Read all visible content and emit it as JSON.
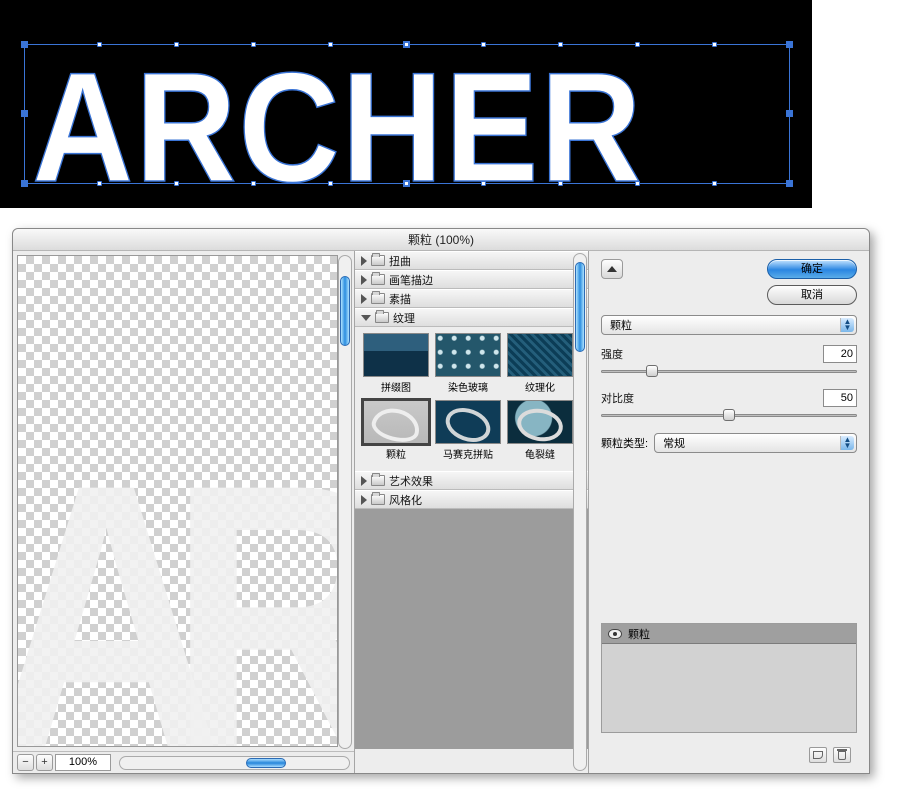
{
  "canvas": {
    "text": "ARCHER"
  },
  "dialog": {
    "title": "颗粒 (100%)",
    "zoom": "100%",
    "categories": [
      {
        "label": "扭曲",
        "open": false
      },
      {
        "label": "画笔描边",
        "open": false
      },
      {
        "label": "素描",
        "open": false
      },
      {
        "label": "纹理",
        "open": true,
        "items": [
          {
            "name": "拼缀图"
          },
          {
            "name": "染色玻璃"
          },
          {
            "name": "纹理化"
          },
          {
            "name": "颗粒",
            "selected": true
          },
          {
            "name": "马赛克拼贴"
          },
          {
            "name": "龟裂缝"
          }
        ]
      },
      {
        "label": "艺术效果",
        "open": false
      },
      {
        "label": "风格化",
        "open": false
      }
    ],
    "buttons": {
      "ok": "确定",
      "cancel": "取消"
    },
    "filter_select": "颗粒",
    "params": {
      "intensity_label": "强度",
      "intensity_value": "20",
      "contrast_label": "对比度",
      "contrast_value": "50",
      "type_label": "颗粒类型:",
      "type_value": "常规"
    },
    "layer_name": "颗粒"
  }
}
